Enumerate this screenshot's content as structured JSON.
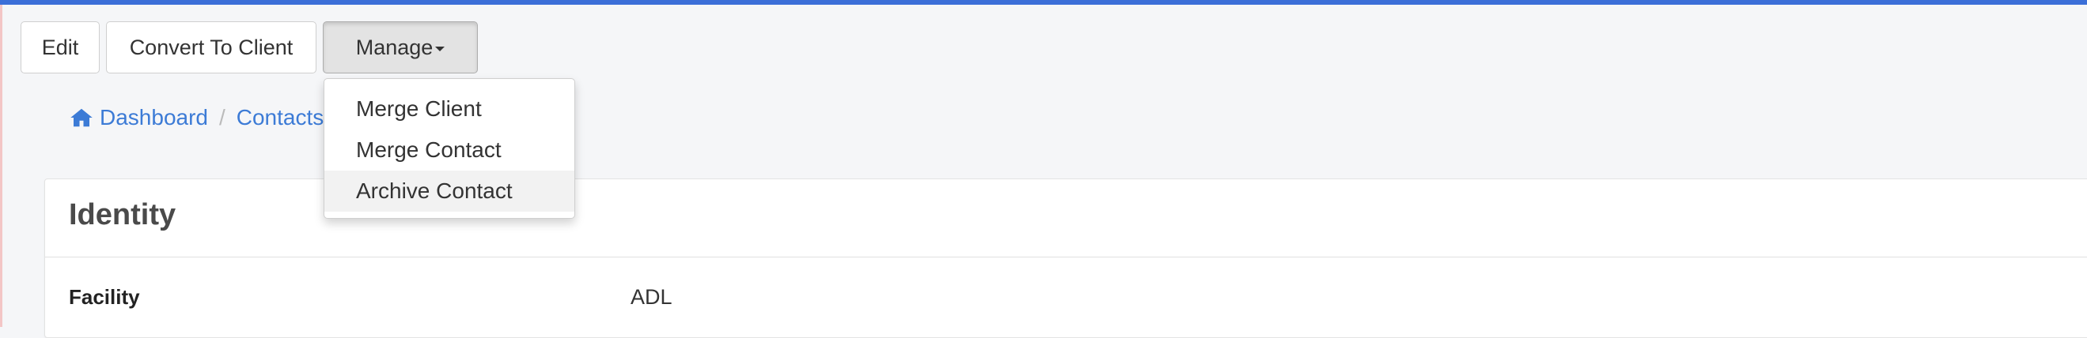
{
  "toolbar": {
    "edit_label": "Edit",
    "convert_label": "Convert To Client",
    "manage_label": "Manage"
  },
  "manage_menu": {
    "items": [
      {
        "label": "Merge Client"
      },
      {
        "label": "Merge Contact"
      },
      {
        "label": "Archive Contact"
      }
    ]
  },
  "breadcrumb": {
    "dashboard": "Dashboard",
    "contacts": "Contacts"
  },
  "panel": {
    "title": "Identity",
    "fields": [
      {
        "label": "Facility",
        "value": "ADL"
      }
    ]
  },
  "colors": {
    "accent": "#3b6fd8",
    "link": "#3c7bd6"
  },
  "icons": [
    "home-icon",
    "caret-down-icon"
  ]
}
